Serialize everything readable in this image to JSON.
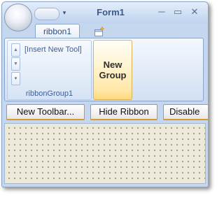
{
  "window": {
    "title": "Form1",
    "controls": {
      "minimize": "─",
      "maximize": "▭",
      "close": "✕"
    }
  },
  "qat": {
    "dropdown_glyph": "▾"
  },
  "tabs": [
    {
      "label": "ribbon1"
    }
  ],
  "ribbon": {
    "group1": {
      "insert_tool_label": "[Insert New Tool]",
      "label": "ribbonGroup1",
      "scroll_glyphs": {
        "up": "▲",
        "down": "▼",
        "more": "▾"
      }
    },
    "new_group_button": {
      "line1": "New",
      "line2": "Group"
    }
  },
  "toolbar": {
    "buttons": [
      {
        "label": "New Toolbar..."
      },
      {
        "label": "Hide Ribbon"
      },
      {
        "label": "Disable"
      }
    ]
  },
  "colors": {
    "title_text": "#3c5a86",
    "ribbon_text": "#3d5f95",
    "button_accent": "#d99a2b",
    "canvas_background": "#ece9d8"
  }
}
